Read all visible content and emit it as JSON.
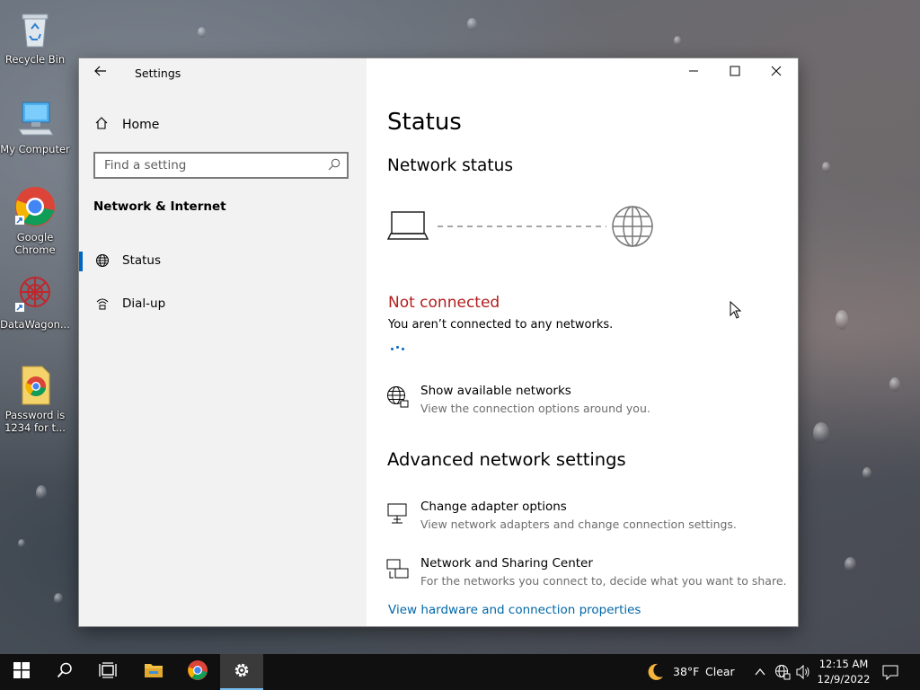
{
  "desktop": {
    "icons": [
      {
        "label": "Recycle Bin",
        "icon": "recycle-bin-icon"
      },
      {
        "label": "My Computer",
        "icon": "computer-icon"
      },
      {
        "label": "Google Chrome",
        "icon": "chrome-icon"
      },
      {
        "label": "DataWagon...",
        "icon": "datawagon-icon"
      },
      {
        "label": "Password is 1234 for t...",
        "icon": "chrome-document-icon"
      }
    ]
  },
  "window": {
    "app_title": "Settings",
    "back_icon": "back-arrow-icon",
    "controls": {
      "minimize": "minimize-icon",
      "maximize": "maximize-icon",
      "close": "close-icon"
    }
  },
  "nav": {
    "home_label": "Home",
    "search_placeholder": "Find a setting",
    "section_title": "Network & Internet",
    "items": [
      {
        "label": "Status",
        "icon": "globe-icon",
        "selected": true
      },
      {
        "label": "Dial-up",
        "icon": "dialup-icon",
        "selected": false
      }
    ]
  },
  "main": {
    "title": "Status",
    "network_status_heading": "Network status",
    "diagram": {
      "device_icon": "laptop-icon",
      "internet_icon": "globe-icon"
    },
    "connection_state": "Not connected",
    "connection_desc": "You aren’t connected to any networks.",
    "show_networks": {
      "title": "Show available networks",
      "desc": "View the connection options around you."
    },
    "advanced_heading": "Advanced network settings",
    "adapter_options": {
      "title": "Change adapter options",
      "desc": "View network adapters and change connection settings."
    },
    "sharing_center": {
      "title": "Network and Sharing Center",
      "desc": "For the networks you connect to, decide what you want to share."
    },
    "hardware_link": "View hardware and connection properties",
    "colors": {
      "error": "#b21d1d",
      "link": "#0067a8",
      "accent": "#0067c0"
    }
  },
  "taskbar": {
    "weather": {
      "temp": "38°F",
      "condition": "Clear",
      "icon": "moon-icon"
    },
    "clock": {
      "time": "12:15 AM",
      "date": "12/9/2022"
    },
    "apps": [
      "start-icon",
      "search-icon",
      "task-view-icon",
      "file-explorer-icon",
      "chrome-icon",
      "settings-gear-icon"
    ]
  }
}
